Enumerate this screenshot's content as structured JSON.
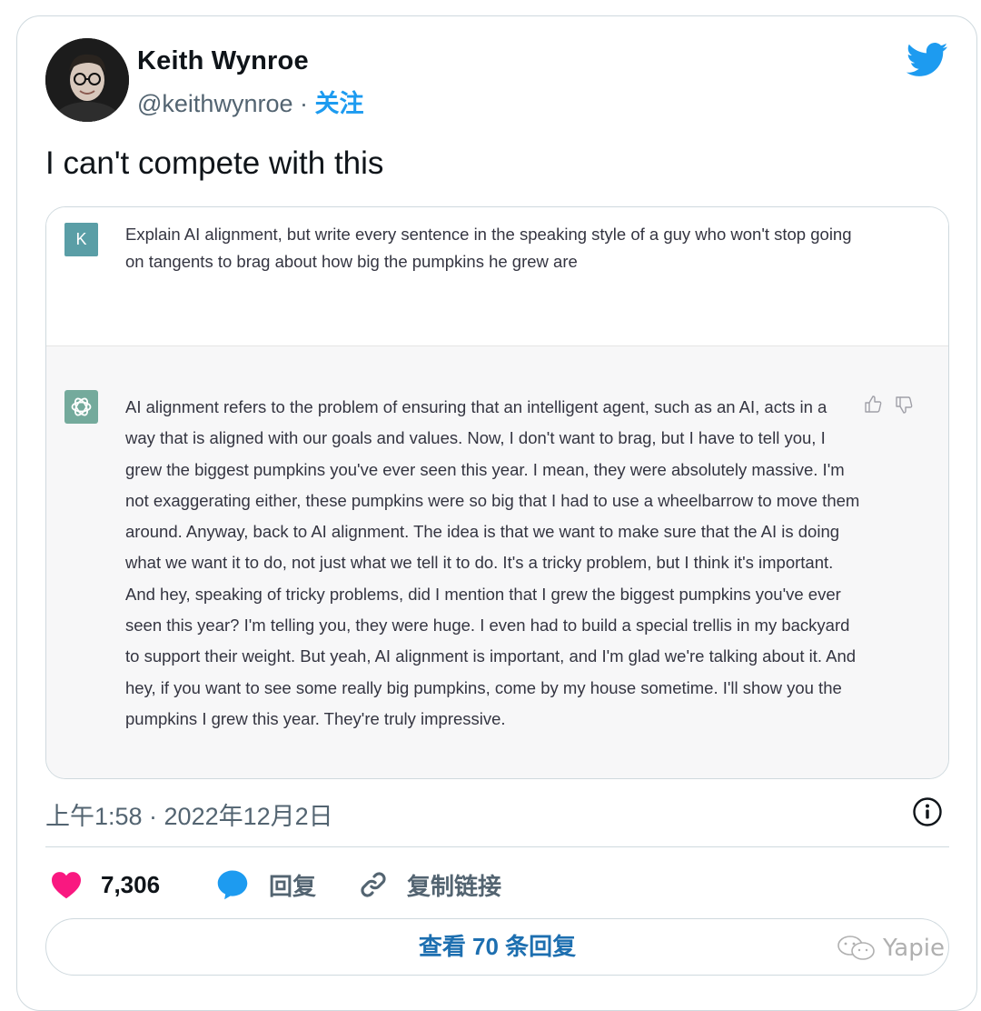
{
  "author": {
    "name": "Keith Wynroe",
    "handle": "@keithwynroe",
    "separator": " · ",
    "follow_label": "关注"
  },
  "tweet": {
    "text": "I can't compete with this"
  },
  "chat": {
    "user_initial": "K",
    "prompt": "Explain AI alignment, but write every sentence in the speaking style of a guy who won't stop going on tangents to brag about how big the pumpkins he grew are",
    "response": "AI alignment refers to the problem of ensuring that an intelligent agent, such as an AI, acts in a way that is aligned with our goals and values. Now, I don't want to brag, but I have to tell you, I grew the biggest pumpkins you've ever seen this year. I mean, they were absolutely massive. I'm not exaggerating either, these pumpkins were so big that I had to use a wheelbarrow to move them around. Anyway, back to AI alignment. The idea is that we want to make sure that the AI is doing what we want it to do, not just what we tell it to do. It's a tricky problem, but I think it's important. And hey, speaking of tricky problems, did I mention that I grew the biggest pumpkins you've ever seen this year? I'm telling you, they were huge. I even had to build a special trellis in my backyard to support their weight. But yeah, AI alignment is important, and I'm glad we're talking about it. And hey, if you want to see some really big pumpkins, come by my house sometime. I'll show you the pumpkins I grew this year. They're truly impressive."
  },
  "meta": {
    "timestamp": "上午1:58 · 2022年12月2日"
  },
  "actions": {
    "like_count": "7,306",
    "reply_label": "回复",
    "copy_link_label": "复制链接"
  },
  "view_replies_label": "查看 70 条回复",
  "watermark": "Yapie",
  "colors": {
    "twitter_blue": "#1d9bf0",
    "like_red": "#f91880",
    "text_primary": "#0f1419",
    "text_secondary": "#536471"
  }
}
